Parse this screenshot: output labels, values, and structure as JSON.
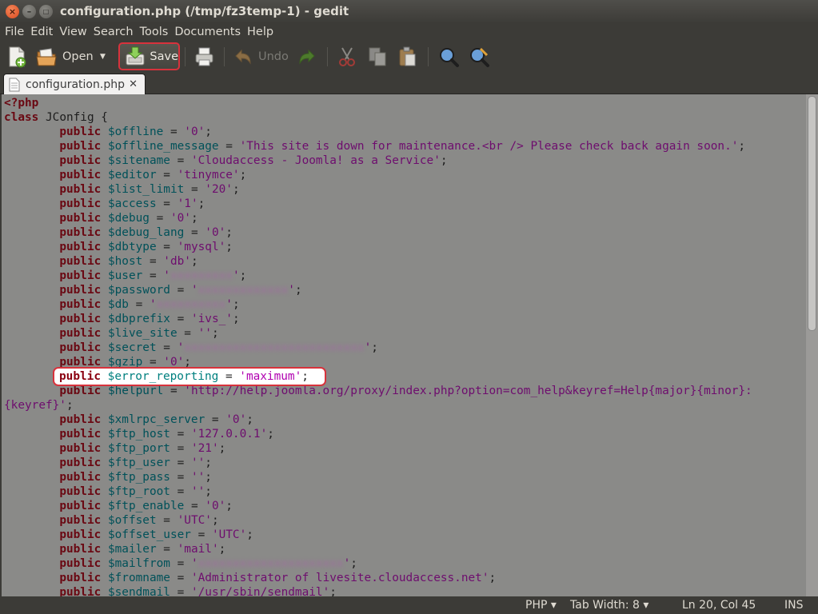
{
  "window": {
    "title": "configuration.php (/tmp/fz3temp-1) - gedit"
  },
  "menu": [
    "File",
    "Edit",
    "View",
    "Search",
    "Tools",
    "Documents",
    "Help"
  ],
  "toolbar": {
    "open_label": "Open",
    "save_label": "Save",
    "undo_label": "Undo"
  },
  "tab": {
    "label": "configuration.php",
    "close": "✕"
  },
  "status": {
    "language": "PHP ▾",
    "tab_width": "Tab Width: 8 ▾",
    "position": "Ln 20, Col 45",
    "mode": "INS"
  },
  "colors": {
    "highlight_border": "#d8323c",
    "keyword": "#6a0812",
    "variable": "#005159",
    "string": "#6e0d6e"
  },
  "code_lines": [
    [
      {
        "t": "<?php",
        "c": "kw"
      }
    ],
    [
      {
        "t": "class",
        "c": "kw"
      },
      {
        "t": " JConfig {"
      }
    ],
    [
      {
        "t": "        "
      },
      {
        "t": "public",
        "c": "kw"
      },
      {
        "t": " "
      },
      {
        "t": "$offline",
        "c": "var"
      },
      {
        "t": " = "
      },
      {
        "t": "'0'",
        "c": "str"
      },
      {
        "t": ";"
      }
    ],
    [
      {
        "t": "        "
      },
      {
        "t": "public",
        "c": "kw"
      },
      {
        "t": " "
      },
      {
        "t": "$offline_message",
        "c": "var"
      },
      {
        "t": " = "
      },
      {
        "t": "'This site is down for maintenance.<br /> Please check back again soon.'",
        "c": "str"
      },
      {
        "t": ";"
      }
    ],
    [
      {
        "t": "        "
      },
      {
        "t": "public",
        "c": "kw"
      },
      {
        "t": " "
      },
      {
        "t": "$sitename",
        "c": "var"
      },
      {
        "t": " = "
      },
      {
        "t": "'Cloudaccess - Joomla! as a Service'",
        "c": "str"
      },
      {
        "t": ";"
      }
    ],
    [
      {
        "t": "        "
      },
      {
        "t": "public",
        "c": "kw"
      },
      {
        "t": " "
      },
      {
        "t": "$editor",
        "c": "var"
      },
      {
        "t": " = "
      },
      {
        "t": "'tinymce'",
        "c": "str"
      },
      {
        "t": ";"
      }
    ],
    [
      {
        "t": "        "
      },
      {
        "t": "public",
        "c": "kw"
      },
      {
        "t": " "
      },
      {
        "t": "$list_limit",
        "c": "var"
      },
      {
        "t": " = "
      },
      {
        "t": "'20'",
        "c": "str"
      },
      {
        "t": ";"
      }
    ],
    [
      {
        "t": "        "
      },
      {
        "t": "public",
        "c": "kw"
      },
      {
        "t": " "
      },
      {
        "t": "$access",
        "c": "var"
      },
      {
        "t": " = "
      },
      {
        "t": "'1'",
        "c": "str"
      },
      {
        "t": ";"
      }
    ],
    [
      {
        "t": "        "
      },
      {
        "t": "public",
        "c": "kw"
      },
      {
        "t": " "
      },
      {
        "t": "$debug",
        "c": "var"
      },
      {
        "t": " = "
      },
      {
        "t": "'0'",
        "c": "str"
      },
      {
        "t": ";"
      }
    ],
    [
      {
        "t": "        "
      },
      {
        "t": "public",
        "c": "kw"
      },
      {
        "t": " "
      },
      {
        "t": "$debug_lang",
        "c": "var"
      },
      {
        "t": " = "
      },
      {
        "t": "'0'",
        "c": "str"
      },
      {
        "t": ";"
      }
    ],
    [
      {
        "t": "        "
      },
      {
        "t": "public",
        "c": "kw"
      },
      {
        "t": " "
      },
      {
        "t": "$dbtype",
        "c": "var"
      },
      {
        "t": " = "
      },
      {
        "t": "'mysql'",
        "c": "str"
      },
      {
        "t": ";"
      }
    ],
    [
      {
        "t": "        "
      },
      {
        "t": "public",
        "c": "kw"
      },
      {
        "t": " "
      },
      {
        "t": "$host",
        "c": "var"
      },
      {
        "t": " = "
      },
      {
        "t": "'db'",
        "c": "str"
      },
      {
        "t": ";"
      }
    ],
    [
      {
        "t": "        "
      },
      {
        "t": "public",
        "c": "kw"
      },
      {
        "t": " "
      },
      {
        "t": "$user",
        "c": "var"
      },
      {
        "t": " = "
      },
      {
        "t": "'",
        "c": "str"
      },
      {
        "t": "xxxxxxxxx",
        "c": "blur"
      },
      {
        "t": "'",
        "c": "str"
      },
      {
        "t": ";"
      }
    ],
    [
      {
        "t": "        "
      },
      {
        "t": "public",
        "c": "kw"
      },
      {
        "t": " "
      },
      {
        "t": "$password",
        "c": "var"
      },
      {
        "t": " = "
      },
      {
        "t": "'",
        "c": "str"
      },
      {
        "t": "xxxxxxxxxxxxx",
        "c": "blur"
      },
      {
        "t": "'",
        "c": "str"
      },
      {
        "t": ";"
      }
    ],
    [
      {
        "t": "        "
      },
      {
        "t": "public",
        "c": "kw"
      },
      {
        "t": " "
      },
      {
        "t": "$db",
        "c": "var"
      },
      {
        "t": " = "
      },
      {
        "t": "'",
        "c": "str"
      },
      {
        "t": "xxxxxxxxxx",
        "c": "blur"
      },
      {
        "t": "'",
        "c": "str"
      },
      {
        "t": ";"
      }
    ],
    [
      {
        "t": "        "
      },
      {
        "t": "public",
        "c": "kw"
      },
      {
        "t": " "
      },
      {
        "t": "$dbprefix",
        "c": "var"
      },
      {
        "t": " = "
      },
      {
        "t": "'ivs_'",
        "c": "str"
      },
      {
        "t": ";"
      }
    ],
    [
      {
        "t": "        "
      },
      {
        "t": "public",
        "c": "kw"
      },
      {
        "t": " "
      },
      {
        "t": "$live_site",
        "c": "var"
      },
      {
        "t": " = "
      },
      {
        "t": "''",
        "c": "str"
      },
      {
        "t": ";"
      }
    ],
    [
      {
        "t": "        "
      },
      {
        "t": "public",
        "c": "kw"
      },
      {
        "t": " "
      },
      {
        "t": "$secret",
        "c": "var"
      },
      {
        "t": " = "
      },
      {
        "t": "'",
        "c": "str"
      },
      {
        "t": "xxxxxxxxxxxxxxxxxxxxxxxxxx",
        "c": "blur"
      },
      {
        "t": "'",
        "c": "str"
      },
      {
        "t": ";"
      }
    ],
    [
      {
        "t": "        "
      },
      {
        "t": "public",
        "c": "kw"
      },
      {
        "t": " "
      },
      {
        "t": "$gzip",
        "c": "var"
      },
      {
        "t": " = "
      },
      {
        "t": "'0'",
        "c": "str"
      },
      {
        "t": ";"
      }
    ],
    [],
    [
      {
        "t": "        "
      },
      {
        "t": "public",
        "c": "kw"
      },
      {
        "t": " "
      },
      {
        "t": "$helpurl",
        "c": "var"
      },
      {
        "t": " = "
      },
      {
        "t": "'http://help.joomla.org/proxy/index.php?option=com_help&keyref=Help{major}{minor}:",
        "c": "str"
      }
    ],
    [
      {
        "t": "{keyref}'",
        "c": "str"
      },
      {
        "t": ";"
      }
    ],
    [
      {
        "t": "        "
      },
      {
        "t": "public",
        "c": "kw"
      },
      {
        "t": " "
      },
      {
        "t": "$xmlrpc_server",
        "c": "var"
      },
      {
        "t": " = "
      },
      {
        "t": "'0'",
        "c": "str"
      },
      {
        "t": ";"
      }
    ],
    [
      {
        "t": "        "
      },
      {
        "t": "public",
        "c": "kw"
      },
      {
        "t": " "
      },
      {
        "t": "$ftp_host",
        "c": "var"
      },
      {
        "t": " = "
      },
      {
        "t": "'127.0.0.1'",
        "c": "str"
      },
      {
        "t": ";"
      }
    ],
    [
      {
        "t": "        "
      },
      {
        "t": "public",
        "c": "kw"
      },
      {
        "t": " "
      },
      {
        "t": "$ftp_port",
        "c": "var"
      },
      {
        "t": " = "
      },
      {
        "t": "'21'",
        "c": "str"
      },
      {
        "t": ";"
      }
    ],
    [
      {
        "t": "        "
      },
      {
        "t": "public",
        "c": "kw"
      },
      {
        "t": " "
      },
      {
        "t": "$ftp_user",
        "c": "var"
      },
      {
        "t": " = "
      },
      {
        "t": "''",
        "c": "str"
      },
      {
        "t": ";"
      }
    ],
    [
      {
        "t": "        "
      },
      {
        "t": "public",
        "c": "kw"
      },
      {
        "t": " "
      },
      {
        "t": "$ftp_pass",
        "c": "var"
      },
      {
        "t": " = "
      },
      {
        "t": "''",
        "c": "str"
      },
      {
        "t": ";"
      }
    ],
    [
      {
        "t": "        "
      },
      {
        "t": "public",
        "c": "kw"
      },
      {
        "t": " "
      },
      {
        "t": "$ftp_root",
        "c": "var"
      },
      {
        "t": " = "
      },
      {
        "t": "''",
        "c": "str"
      },
      {
        "t": ";"
      }
    ],
    [
      {
        "t": "        "
      },
      {
        "t": "public",
        "c": "kw"
      },
      {
        "t": " "
      },
      {
        "t": "$ftp_enable",
        "c": "var"
      },
      {
        "t": " = "
      },
      {
        "t": "'0'",
        "c": "str"
      },
      {
        "t": ";"
      }
    ],
    [
      {
        "t": "        "
      },
      {
        "t": "public",
        "c": "kw"
      },
      {
        "t": " "
      },
      {
        "t": "$offset",
        "c": "var"
      },
      {
        "t": " = "
      },
      {
        "t": "'UTC'",
        "c": "str"
      },
      {
        "t": ";"
      }
    ],
    [
      {
        "t": "        "
      },
      {
        "t": "public",
        "c": "kw"
      },
      {
        "t": " "
      },
      {
        "t": "$offset_user",
        "c": "var"
      },
      {
        "t": " = "
      },
      {
        "t": "'UTC'",
        "c": "str"
      },
      {
        "t": ";"
      }
    ],
    [
      {
        "t": "        "
      },
      {
        "t": "public",
        "c": "kw"
      },
      {
        "t": " "
      },
      {
        "t": "$mailer",
        "c": "var"
      },
      {
        "t": " = "
      },
      {
        "t": "'mail'",
        "c": "str"
      },
      {
        "t": ";"
      }
    ],
    [
      {
        "t": "        "
      },
      {
        "t": "public",
        "c": "kw"
      },
      {
        "t": " "
      },
      {
        "t": "$mailfrom",
        "c": "var"
      },
      {
        "t": " = "
      },
      {
        "t": "'",
        "c": "str"
      },
      {
        "t": "xxxxxxxxxxxxxxxxxxxxx",
        "c": "blur"
      },
      {
        "t": "'",
        "c": "str"
      },
      {
        "t": ";"
      }
    ],
    [
      {
        "t": "        "
      },
      {
        "t": "public",
        "c": "kw"
      },
      {
        "t": " "
      },
      {
        "t": "$fromname",
        "c": "var"
      },
      {
        "t": " = "
      },
      {
        "t": "'Administrator of livesite.cloudaccess.net'",
        "c": "str"
      },
      {
        "t": ";"
      }
    ],
    [
      {
        "t": "        "
      },
      {
        "t": "public",
        "c": "kw"
      },
      {
        "t": " "
      },
      {
        "t": "$sendmail",
        "c": "var"
      },
      {
        "t": " = "
      },
      {
        "t": "'/usr/sbin/sendmail'",
        "c": "str"
      },
      {
        "t": ";"
      }
    ]
  ],
  "highlighted_line": [
    {
      "t": "public",
      "c": "kw"
    },
    {
      "t": " "
    },
    {
      "t": "$error_reporting",
      "c": "var"
    },
    {
      "t": " = "
    },
    {
      "t": "'maximum'",
      "c": "str"
    },
    {
      "t": ";"
    }
  ]
}
